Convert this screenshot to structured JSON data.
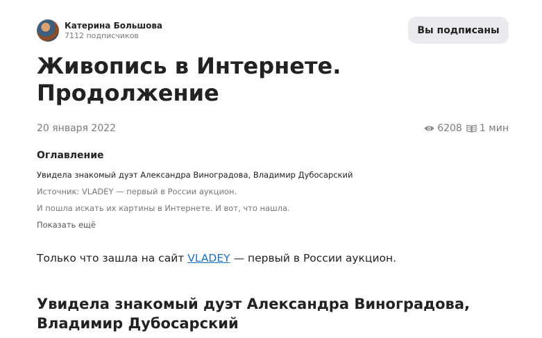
{
  "author": {
    "name": "Катерина Большова",
    "subscribers": "7112 подписчиков"
  },
  "subscribe_button": "Вы подписаны",
  "article": {
    "title": "Живопись в Интернете. Продолжение",
    "date": "20 января 2022",
    "views": "6208",
    "read_time": "1 мин"
  },
  "toc": {
    "heading": "Оглавление",
    "items": [
      "Увидела знакомый дуэт Александра Виноградова, Владимир Дубосарский",
      "Источник: VLADEY — первый в России аукцион.",
      "И пошла искать их картины в Интернете. И вот, что нашла."
    ],
    "show_more": "Показать ещё"
  },
  "body": {
    "para_prefix": "Только что зашла на сайт ",
    "link_text": "VLADEY",
    "para_suffix": " — первый в России аукцион.",
    "section_heading": "Увидела знакомый дуэт Александра Виноградова, Владимир Дубосарский"
  },
  "icons": {
    "views": "eye-icon",
    "read_time": "book-icon"
  }
}
